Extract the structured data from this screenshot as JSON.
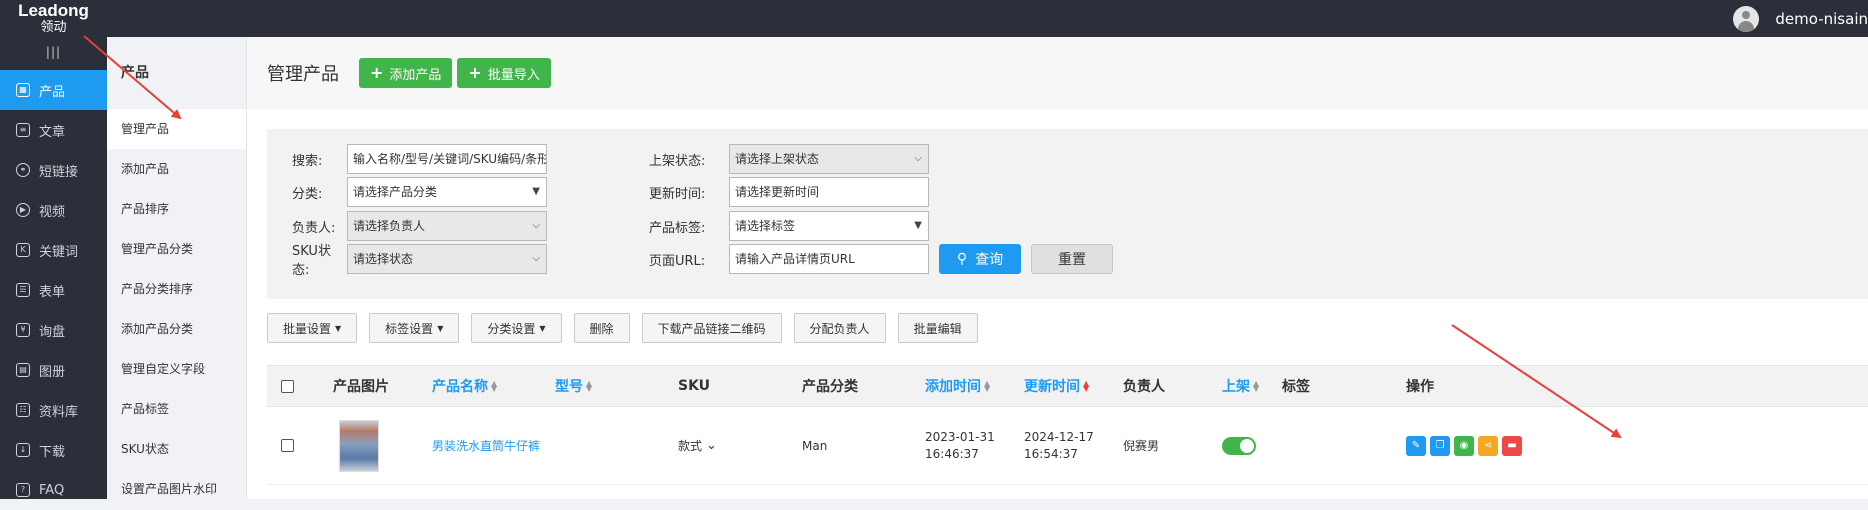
{
  "logo": {
    "line1": "Leadong",
    "line2": "领动"
  },
  "user": {
    "name": "demo-nisain"
  },
  "sidebar": {
    "collapse_label": "|||",
    "items": [
      {
        "label": "产品",
        "icon": "grid-icon",
        "glyph": "▦"
      },
      {
        "label": "文章",
        "icon": "article-icon",
        "glyph": "≡"
      },
      {
        "label": "短链接",
        "icon": "link-icon",
        "glyph": "⚭"
      },
      {
        "label": "视频",
        "icon": "play-icon",
        "glyph": "▶"
      },
      {
        "label": "关键词",
        "icon": "keyword-icon",
        "glyph": "K"
      },
      {
        "label": "表单",
        "icon": "clipboard-icon",
        "glyph": "☰"
      },
      {
        "label": "询盘",
        "icon": "inquiry-icon",
        "glyph": "¥"
      },
      {
        "label": "图册",
        "icon": "album-icon",
        "glyph": "▤"
      },
      {
        "label": "资料库",
        "icon": "library-icon",
        "glyph": "☷"
      },
      {
        "label": "下载",
        "icon": "download-icon",
        "glyph": "↓"
      },
      {
        "label": "FAQ",
        "icon": "faq-icon",
        "glyph": "?"
      }
    ]
  },
  "subnav": {
    "title": "产品",
    "items": [
      "管理产品",
      "添加产品",
      "产品排序",
      "管理产品分类",
      "产品分类排序",
      "添加产品分类",
      "管理自定义字段",
      "产品标签",
      "SKU状态",
      "设置产品图片水印"
    ]
  },
  "header": {
    "title": "管理产品",
    "add_label": "添加产品",
    "import_label": "批量导入"
  },
  "filters": {
    "search_label": "搜索:",
    "search_placeholder": "输入名称/型号/关键词/SKU编码/条形",
    "category_label": "分类:",
    "category_value": "请选择产品分类",
    "owner_label": "负责人:",
    "owner_value": "请选择负责人",
    "sku_label": "SKU状态:",
    "sku_value": "请选择状态",
    "publish_label": "上架状态:",
    "publish_value": "请选择上架状态",
    "updated_label": "更新时间:",
    "updated_placeholder": "请选择更新时间",
    "tag_label": "产品标签:",
    "tag_value": "请选择标签",
    "url_label": "页面URL:",
    "url_placeholder": "请输入产品详情页URL",
    "query_label": "查询",
    "reset_label": "重置"
  },
  "toolbar": {
    "batch_settings": "批量设置",
    "tag_settings": "标签设置",
    "category_settings": "分类设置",
    "delete": "删除",
    "qr": "下载产品链接二维码",
    "assign": "分配负责人",
    "batch_edit": "批量编辑"
  },
  "table": {
    "headers": {
      "image": "产品图片",
      "name": "产品名称",
      "model": "型号",
      "sku": "SKU",
      "category": "产品分类",
      "added": "添加时间",
      "updated": "更新时间",
      "owner": "负责人",
      "published": "上架",
      "tags": "标签",
      "actions": "操作"
    },
    "rows": [
      {
        "name": "男装洗水直筒牛仔裤",
        "model": "",
        "sku": "款式",
        "category": "Man",
        "added_date": "2023-01-31",
        "added_time": "16:46:37",
        "updated_date": "2024-12-17",
        "updated_time": "16:54:37",
        "owner": "倪赛男",
        "published": true,
        "tags": ""
      }
    ]
  },
  "colors": {
    "accent": "#1e9bf0",
    "green": "#3fb54a",
    "edit": "#1e9bf0",
    "copy": "#1e9bf0",
    "view": "#3fb54a",
    "share": "#f5a623",
    "delete": "#f04848",
    "annotation": "#e8403a"
  }
}
